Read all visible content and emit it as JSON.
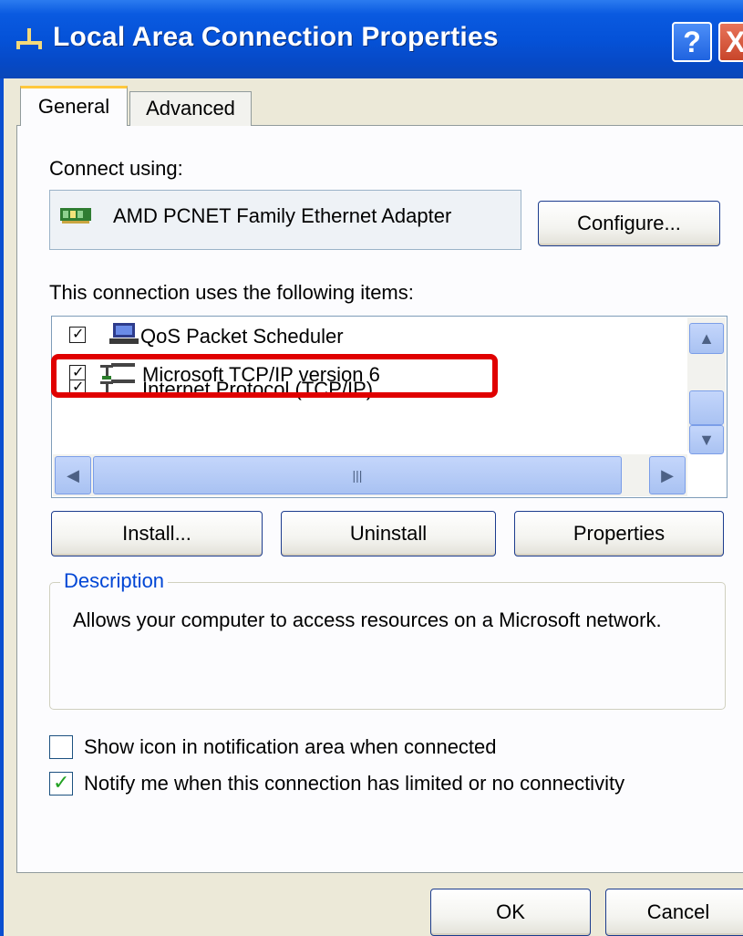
{
  "window": {
    "title": "Local Area Connection Properties",
    "help_glyph": "?",
    "close_glyph": "X"
  },
  "tabs": [
    {
      "label": "General",
      "selected": true
    },
    {
      "label": "Advanced",
      "selected": false
    }
  ],
  "connect_using": {
    "label": "Connect using:",
    "adapter_name": "AMD PCNET Family Ethernet Adapter",
    "configure_label": "Configure..."
  },
  "items_list": {
    "label": "This connection uses the following items:",
    "items": [
      {
        "label": "QoS Packet Scheduler",
        "checked": true,
        "icon": "network-service-icon"
      },
      {
        "label": "Microsoft TCP/IP version 6",
        "checked": true,
        "icon": "protocol-icon"
      },
      {
        "label": "Internet Protocol (TCP/IP)",
        "checked": true,
        "icon": "protocol-icon"
      }
    ],
    "highlighted_item": "Microsoft TCP/IP version 6"
  },
  "buttons": {
    "install": "Install...",
    "uninstall": "Uninstall",
    "properties": "Properties",
    "ok": "OK",
    "cancel": "Cancel"
  },
  "description": {
    "legend": "Description",
    "text": "Allows your computer to access resources on a Microsoft network."
  },
  "options": {
    "show_icon": {
      "label": "Show icon in notification area when connected",
      "checked": false
    },
    "notify": {
      "label": "Notify me when this connection has limited or no connectivity",
      "checked": true
    }
  },
  "colors": {
    "titlebar": "#0552d8",
    "dialog_bg": "#ece9d8",
    "highlight": "#e00000",
    "legend_text": "#0046d5"
  }
}
